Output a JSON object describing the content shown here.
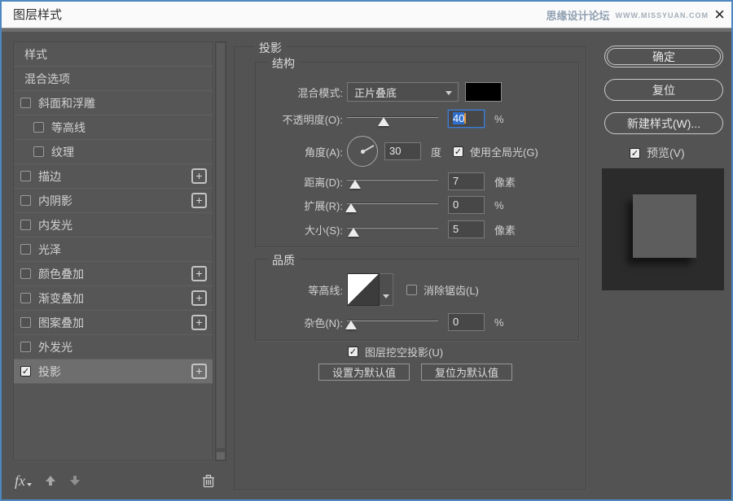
{
  "title_bar": {
    "title": "图层样式",
    "watermark_cn": "思缘设计论坛",
    "watermark_url": "WWW.MISSYUAN.COM"
  },
  "glyphs": {
    "check": "✓",
    "plus": "+",
    "close": "×"
  },
  "sidebar": {
    "items": [
      {
        "label": "样式",
        "checkbox": null,
        "add_button": false,
        "indent": 0,
        "selected": false
      },
      {
        "label": "混合选项",
        "checkbox": null,
        "add_button": false,
        "indent": 0,
        "selected": false
      },
      {
        "label": "斜面和浮雕",
        "checkbox": false,
        "add_button": false,
        "indent": 0,
        "selected": false
      },
      {
        "label": "等高线",
        "checkbox": false,
        "add_button": false,
        "indent": 1,
        "selected": false
      },
      {
        "label": "纹理",
        "checkbox": false,
        "add_button": false,
        "indent": 1,
        "selected": false
      },
      {
        "label": "描边",
        "checkbox": false,
        "add_button": true,
        "indent": 0,
        "selected": false
      },
      {
        "label": "内阴影",
        "checkbox": false,
        "add_button": true,
        "indent": 0,
        "selected": false
      },
      {
        "label": "内发光",
        "checkbox": false,
        "add_button": false,
        "indent": 0,
        "selected": false
      },
      {
        "label": "光泽",
        "checkbox": false,
        "add_button": false,
        "indent": 0,
        "selected": false
      },
      {
        "label": "颜色叠加",
        "checkbox": false,
        "add_button": true,
        "indent": 0,
        "selected": false
      },
      {
        "label": "渐变叠加",
        "checkbox": false,
        "add_button": true,
        "indent": 0,
        "selected": false
      },
      {
        "label": "图案叠加",
        "checkbox": false,
        "add_button": true,
        "indent": 0,
        "selected": false
      },
      {
        "label": "外发光",
        "checkbox": false,
        "add_button": false,
        "indent": 0,
        "selected": false
      },
      {
        "label": "投影",
        "checkbox": true,
        "add_button": true,
        "indent": 0,
        "selected": true
      }
    ],
    "footer": {
      "fx_label": "fx"
    }
  },
  "panel": {
    "title": "投影",
    "structure": {
      "legend": "结构",
      "blend_mode_label": "混合模式:",
      "blend_mode_value": "正片叠底",
      "opacity_label": "不透明度(O):",
      "opacity_value": "40",
      "opacity_unit": "%",
      "angle_label": "角度(A):",
      "angle_value": "30",
      "angle_unit": "度",
      "global_light_label": "使用全局光(G)",
      "global_light_checked": true,
      "distance_label": "距离(D):",
      "distance_value": "7",
      "distance_unit": "像素",
      "spread_label": "扩展(R):",
      "spread_value": "0",
      "spread_unit": "%",
      "size_label": "大小(S):",
      "size_value": "5",
      "size_unit": "像素"
    },
    "quality": {
      "legend": "品质",
      "contour_label": "等高线:",
      "antialias_label": "消除锯齿(L)",
      "antialias_checked": false,
      "noise_label": "杂色(N):",
      "noise_value": "0",
      "noise_unit": "%"
    },
    "knockout_label": "图层挖空投影(U)",
    "knockout_checked": true,
    "set_default_label": "设置为默认值",
    "reset_default_label": "复位为默认值"
  },
  "actions": {
    "ok": "确定",
    "reset": "复位",
    "new_style": "新建样式(W)...",
    "preview": "预览(V)",
    "preview_checked": true
  },
  "colors": {
    "dialog_bg": "#535353",
    "selection_blue": "#2e6fd0",
    "focus_blue": "#3b7dd8",
    "caret_orange": "#e0963c",
    "swatch_black": "#000000",
    "edge_blue": "#4e86c0"
  }
}
